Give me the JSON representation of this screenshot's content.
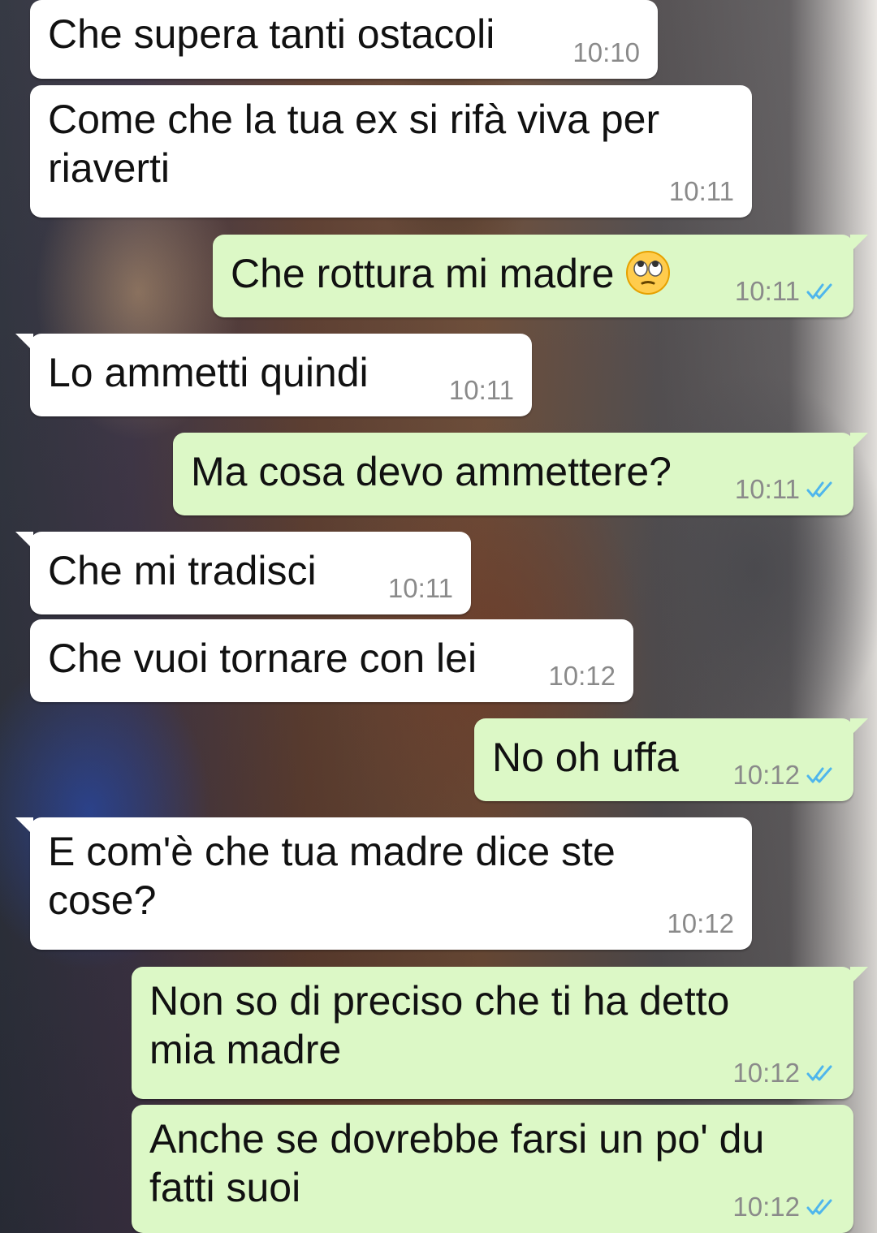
{
  "messages": [
    {
      "text": "Che supera tanti ostacoli",
      "time": "10:10",
      "direction": "incoming"
    },
    {
      "text": "Come che la tua ex si rifà viva per riaverti",
      "time": "10:11",
      "direction": "incoming"
    },
    {
      "text": "Che rottura mi madre",
      "emoji": "face-with-rolling-eyes",
      "time": "10:11",
      "direction": "outgoing",
      "status": "read"
    },
    {
      "text": "Lo ammetti quindi",
      "time": "10:11",
      "direction": "incoming"
    },
    {
      "text": "Ma cosa devo ammettere?",
      "time": "10:11",
      "direction": "outgoing",
      "status": "read"
    },
    {
      "text": "Che mi tradisci",
      "time": "10:11",
      "direction": "incoming"
    },
    {
      "text": "Che vuoi tornare con lei",
      "time": "10:12",
      "direction": "incoming"
    },
    {
      "text": "No oh uffa",
      "time": "10:12",
      "direction": "outgoing",
      "status": "read"
    },
    {
      "text": "E com'è che tua madre dice ste cose?",
      "time": "10:12",
      "direction": "incoming"
    },
    {
      "text": "Non so di preciso che ti ha detto mia madre",
      "time": "10:12",
      "direction": "outgoing",
      "status": "read"
    },
    {
      "text": "Anche se dovrebbe farsi un po' du fatti suoi",
      "time": "10:12",
      "direction": "outgoing",
      "status": "read"
    }
  ],
  "colors": {
    "incoming_bubble": "#ffffff",
    "outgoing_bubble": "#dcf8c6",
    "timestamp": "#8a8a8a",
    "read_ticks": "#4fb6ec"
  }
}
